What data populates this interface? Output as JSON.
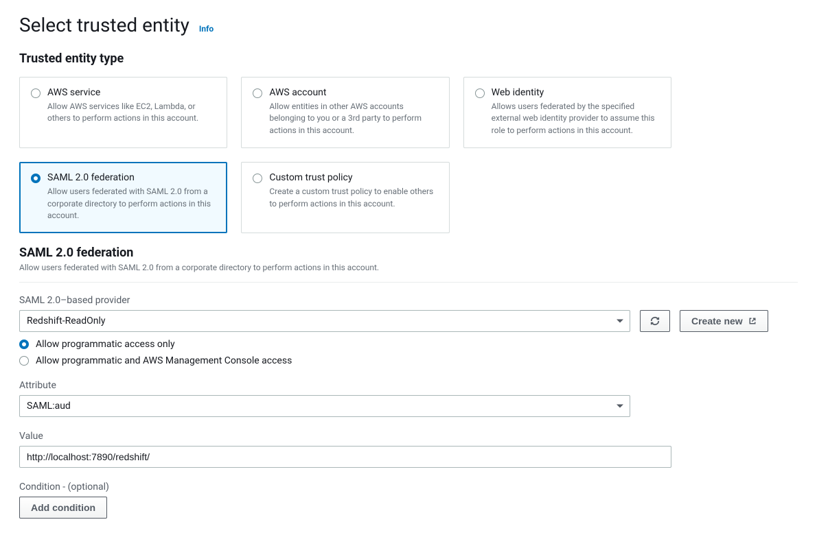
{
  "page": {
    "title": "Select trusted entity",
    "info_label": "Info"
  },
  "entity_type": {
    "heading": "Trusted entity type",
    "options": [
      {
        "title": "AWS service",
        "desc": "Allow AWS services like EC2, Lambda, or others to perform actions in this account.",
        "selected": false
      },
      {
        "title": "AWS account",
        "desc": "Allow entities in other AWS accounts belonging to you or a 3rd party to perform actions in this account.",
        "selected": false
      },
      {
        "title": "Web identity",
        "desc": "Allows users federated by the specified external web identity provider to assume this role to perform actions in this account.",
        "selected": false
      },
      {
        "title": "SAML 2.0 federation",
        "desc": "Allow users federated with SAML 2.0 from a corporate directory to perform actions in this account.",
        "selected": true
      },
      {
        "title": "Custom trust policy",
        "desc": "Create a custom trust policy to enable others to perform actions in this account.",
        "selected": false
      }
    ]
  },
  "saml_section": {
    "heading": "SAML 2.0 federation",
    "desc": "Allow users federated with SAML 2.0 from a corporate directory to perform actions in this account."
  },
  "provider": {
    "label": "SAML 2.0–based provider",
    "selected": "Redshift-ReadOnly",
    "create_new_label": "Create new"
  },
  "access": {
    "options": [
      {
        "label": "Allow programmatic access only",
        "selected": true
      },
      {
        "label": "Allow programmatic and AWS Management Console access",
        "selected": false
      }
    ]
  },
  "attribute": {
    "label": "Attribute",
    "selected": "SAML:aud"
  },
  "value": {
    "label": "Value",
    "text": "http://localhost:7890/redshift/"
  },
  "condition": {
    "label": "Condition - (optional)",
    "button": "Add condition"
  }
}
